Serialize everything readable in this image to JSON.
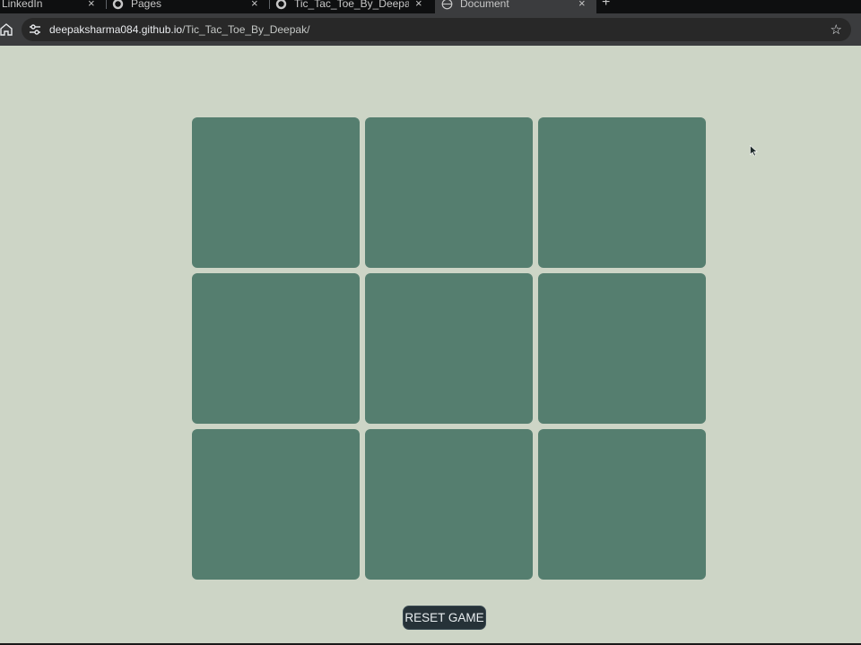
{
  "browser": {
    "tabs": [
      {
        "title": "LinkedIn",
        "active": false,
        "icon": "linkedin-icon"
      },
      {
        "title": "Pages",
        "active": false,
        "icon": "github-icon"
      },
      {
        "title": "Tic_Tac_Toe_By_Deepak/index.ht",
        "active": false,
        "icon": "github-icon"
      },
      {
        "title": "Document",
        "active": true,
        "icon": "globe-icon"
      }
    ],
    "new_tab_label": "+",
    "close_glyph": "×",
    "url_host": "deepaksharma084.github.io",
    "url_path": "/Tic_Tac_Toe_By_Deepak/"
  },
  "game": {
    "cells": [
      "",
      "",
      "",
      "",
      "",
      "",
      "",
      "",
      ""
    ],
    "reset_label": "RESET GAME"
  },
  "colors": {
    "page_bg": "#cdd5c6",
    "cell": "#557e6f",
    "button": "#263238"
  }
}
